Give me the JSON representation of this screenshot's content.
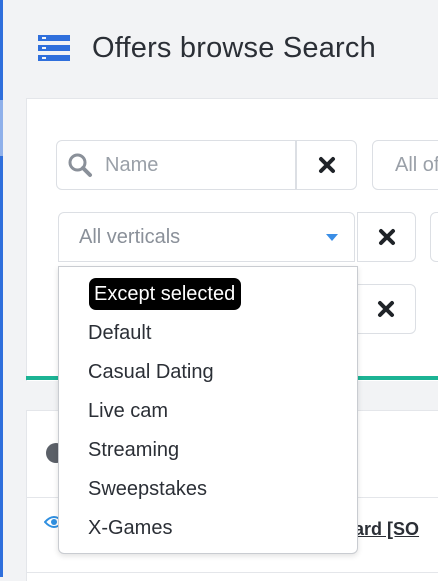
{
  "page": {
    "title": "Offers browse Search"
  },
  "filters": {
    "name_placeholder": "Name",
    "offers_select_value": "All of",
    "verticals_select_value": "All verticals"
  },
  "verticals_dropdown": {
    "options": [
      {
        "label": "Except selected",
        "selected": true
      },
      {
        "label": "Default"
      },
      {
        "label": "Casual Dating"
      },
      {
        "label": "Live cam"
      },
      {
        "label": "Streaming"
      },
      {
        "label": "Sweepstakes"
      },
      {
        "label": "X-Games"
      }
    ]
  },
  "offers_list": {
    "first_row_link": "tcard [SO"
  },
  "icons": {
    "menu": "hamburger-menu-icon",
    "search": "search-icon",
    "clear": "close-icon",
    "help": "help-icon",
    "view": "eye-icon"
  },
  "colors": {
    "brand_blue": "#2f6fdc",
    "accent_green": "#1cb394",
    "caret_blue": "#3a8ee6",
    "selected_option_bg": "#000000"
  }
}
